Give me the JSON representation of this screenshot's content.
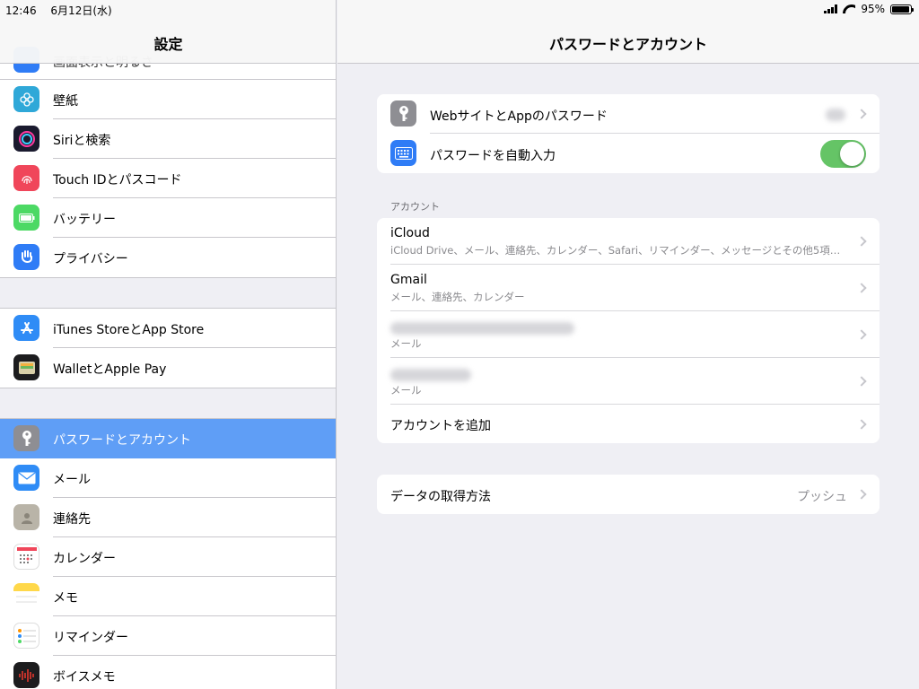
{
  "status_bar": {
    "time": "12:46",
    "date": "6月12日(水)",
    "battery_text": "95%",
    "battery_level": 0.95
  },
  "sidebar": {
    "title": "設定",
    "cut_item": {
      "label": "画面表示と明るさ"
    },
    "groups": [
      [
        {
          "label": "壁紙",
          "icon": "wallpaper-icon",
          "color": "#2fa8d8"
        },
        {
          "label": "Siriと検索",
          "icon": "siri-icon",
          "color": "#1a1a2e"
        },
        {
          "label": "Touch IDとパスコード",
          "icon": "fingerprint-icon",
          "color": "#f0465a"
        },
        {
          "label": "バッテリー",
          "icon": "battery-icon",
          "color": "#4cd964"
        },
        {
          "label": "プライバシー",
          "icon": "hand-icon",
          "color": "#2f7cf6"
        }
      ],
      [
        {
          "label": "iTunes StoreとApp Store",
          "icon": "app-store-icon",
          "color": "#2f8cf6"
        },
        {
          "label": "WalletとApple Pay",
          "icon": "wallet-icon",
          "color": "#1c1c1e"
        }
      ],
      [
        {
          "label": "パスワードとアカウント",
          "icon": "key-icon",
          "color": "#8e8e93",
          "selected": true
        },
        {
          "label": "メール",
          "icon": "mail-icon",
          "color": "#2f8cf6"
        },
        {
          "label": "連絡先",
          "icon": "contacts-icon",
          "color": "#b9b4a8"
        },
        {
          "label": "カレンダー",
          "icon": "calendar-icon",
          "color": "#ffffff"
        },
        {
          "label": "メモ",
          "icon": "notes-icon",
          "color": "#ffd84a"
        },
        {
          "label": "リマインダー",
          "icon": "reminders-icon",
          "color": "#ffffff"
        },
        {
          "label": "ボイスメモ",
          "icon": "voice-memo-icon",
          "color": "#1c1c1e"
        }
      ]
    ]
  },
  "detail": {
    "title": "パスワードとアカウント",
    "passwords": {
      "website_passwords": "WebサイトとAppのパスワード",
      "autofill": "パスワードを自動入力",
      "autofill_on": true
    },
    "accounts_header": "アカウント",
    "accounts": [
      {
        "name": "iCloud",
        "detail": "iCloud Drive、メール、連絡先、カレンダー、Safari、リマインダー、メッセージとその他5項目…"
      },
      {
        "name": "Gmail",
        "detail": "メール、連絡先、カレンダー"
      },
      {
        "name": "",
        "detail": "メール"
      },
      {
        "name": "",
        "detail": "メール"
      }
    ],
    "add_account": "アカウントを追加",
    "fetch": {
      "label": "データの取得方法",
      "value": "プッシュ"
    }
  }
}
